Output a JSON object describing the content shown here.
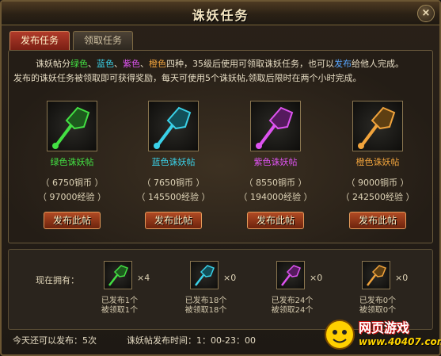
{
  "window": {
    "title": "诛妖任务",
    "close_glyph": "×"
  },
  "tabs": [
    {
      "label": "发布任务",
      "active": true
    },
    {
      "label": "领取任务",
      "active": false
    }
  ],
  "intro": {
    "line1_a": "诛妖帖分",
    "green": "绿色",
    "sep1": "、",
    "cyan": "蓝色",
    "sep2": "、",
    "purple": "紫色",
    "sep3": "、",
    "orange": "橙色",
    "line1_b": "四种，35级后使用可领取诛妖任务，也可以",
    "publish_word": "发布",
    "line1_c": "给他人完成。",
    "line2": "发布的诛妖任务被领取即可获得奖励，每天可使用5个诛妖帖,领取后限时在两个小时完成。"
  },
  "cards": [
    {
      "name": "绿色诛妖帖",
      "color": "#43e043",
      "cost": "（  6750铜币  ）",
      "reward": "（ 97000经验 ）",
      "button": "发布此帖"
    },
    {
      "name": "蓝色诛妖帖",
      "color": "#3ad1e8",
      "cost": "（  7650铜币  ）",
      "reward": "（ 145500经验 ）",
      "button": "发布此帖"
    },
    {
      "name": "紫色诛妖帖",
      "color": "#dd53f0",
      "cost": "（  8550铜币  ）",
      "reward": "（ 194000经验 ）",
      "button": "发布此帖"
    },
    {
      "name": "橙色诛妖帖",
      "color": "#f0a33c",
      "cost": "（  9000铜币  ）",
      "reward": "（ 242500经验 ）",
      "button": "发布此帖"
    }
  ],
  "owned": {
    "label": "现在拥有：",
    "items": [
      {
        "count": "×4",
        "published": "已发布1个",
        "claimed": "被领取1个",
        "color": "#43e043"
      },
      {
        "count": "×0",
        "published": "已发布18个",
        "claimed": "被领取18个",
        "color": "#3ad1e8"
      },
      {
        "count": "×0",
        "published": "已发布24个",
        "claimed": "被领取24个",
        "color": "#dd53f0"
      },
      {
        "count": "×0",
        "published": "已发布0个",
        "claimed": "被领取0个",
        "color": "#f0a33c"
      }
    ]
  },
  "footer": {
    "remaining": "今天还可以发布：5次",
    "time": "诛妖帖发布时间：1：00-23：00"
  },
  "watermark": {
    "line1": "网页游戏",
    "line2": "www.40407.com"
  }
}
